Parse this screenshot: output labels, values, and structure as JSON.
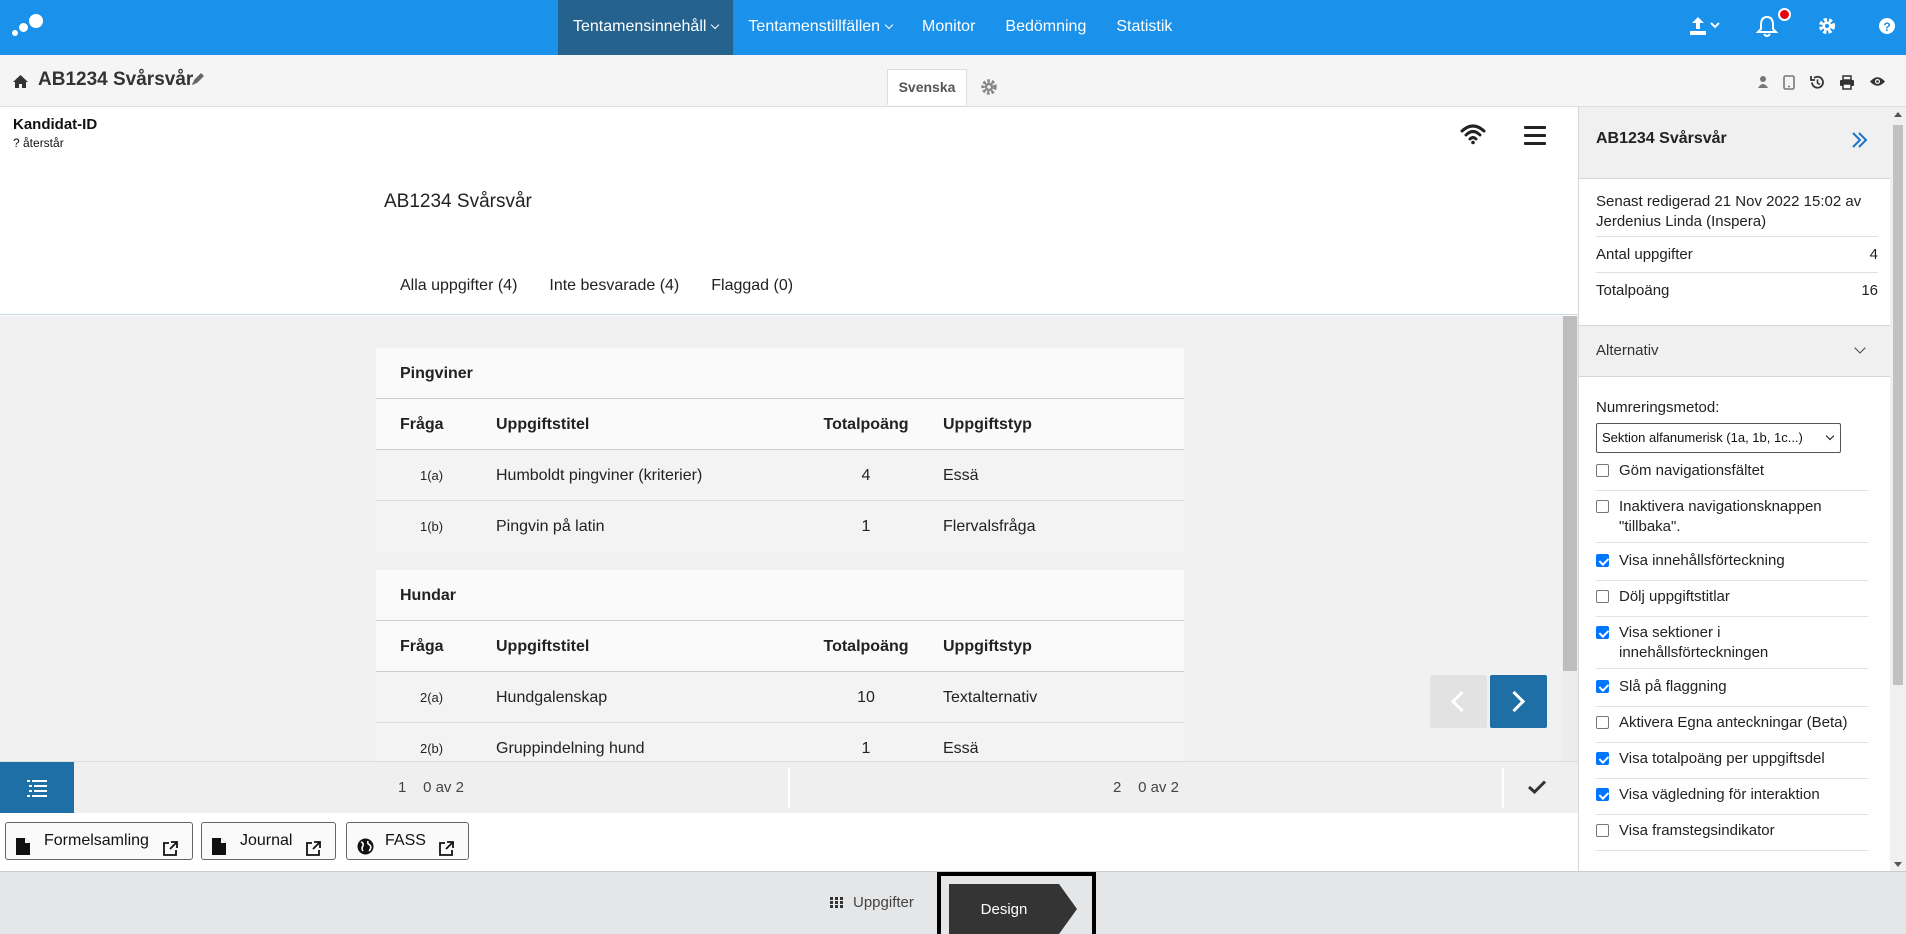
{
  "topnav": {
    "items": [
      {
        "label": "Tentamensinnehåll",
        "dropdown": true,
        "active": true
      },
      {
        "label": "Tentamenstillfällen",
        "dropdown": true,
        "active": false
      },
      {
        "label": "Monitor",
        "dropdown": false,
        "active": false
      },
      {
        "label": "Bedömning",
        "dropdown": false,
        "active": false
      },
      {
        "label": "Statistik",
        "dropdown": false,
        "active": false
      }
    ],
    "icons": [
      "upload-icon",
      "bell-icon",
      "gear-icon",
      "help-icon"
    ],
    "colors": {
      "bar": "#1a91ea",
      "active": "#25628e",
      "notification": "#e8000f"
    }
  },
  "subheader": {
    "title": "AB1234 Svårsvår",
    "language_tab": "Svenska",
    "tool_icons": [
      "person-icon",
      "tablet-icon",
      "history-icon",
      "print-icon",
      "eye-icon"
    ]
  },
  "candidate": {
    "id_label": "Kandidat-ID",
    "remaining": "? återstår"
  },
  "document": {
    "title": "AB1234 Svårsvår",
    "filters": [
      "Alla uppgifter (4)",
      "Inte besvarade (4)",
      "Flaggad (0)"
    ]
  },
  "table_headers": {
    "question": "Fråga",
    "title": "Uppgiftstitel",
    "points": "Totalpoäng",
    "type": "Uppgiftstyp"
  },
  "sections": [
    {
      "name": "Pingviner",
      "rows": [
        {
          "q": "1(a)",
          "title": "Humboldt pingviner (kriterier)",
          "points": "4",
          "type": "Essä"
        },
        {
          "q": "1(b)",
          "title": "Pingvin på latin",
          "points": "1",
          "type": "Flervalsfråga"
        }
      ]
    },
    {
      "name": "Hundar",
      "rows": [
        {
          "q": "2(a)",
          "title": "Hundgalenskap",
          "points": "10",
          "type": "Textalternativ"
        },
        {
          "q": "2(b)",
          "title": "Gruppindelning hund",
          "points": "1",
          "type": "Essä"
        }
      ]
    }
  ],
  "progress": {
    "segments": [
      {
        "num": "1",
        "status": "0 av 2"
      },
      {
        "num": "2",
        "status": "0 av 2"
      }
    ]
  },
  "resources": [
    {
      "label": "Formelsamling",
      "icon": "document-icon"
    },
    {
      "label": "Journal",
      "icon": "document-icon"
    },
    {
      "label": "FASS",
      "icon": "globe-icon"
    }
  ],
  "bottombar": {
    "tasks_label": "Uppgifter",
    "design_label": "Design"
  },
  "panel": {
    "title": "AB1234 Svårsvår",
    "last_edited": "Senast redigerad 21 Nov 2022 15:02 av Jerdenius Linda (Inspera)",
    "stats": [
      {
        "label": "Antal uppgifter",
        "value": "4"
      },
      {
        "label": "Totalpoäng",
        "value": "16"
      }
    ],
    "alternatives_label": "Alternativ",
    "numbering_label": "Numreringsmetod:",
    "numbering_value": "Sektion alfanumerisk (1a, 1b, 1c...)",
    "options": [
      {
        "label": "Göm navigationsfältet",
        "checked": false
      },
      {
        "label": "Inaktivera navigationsknappen \"tillbaka\".",
        "checked": false
      },
      {
        "label": "Visa innehållsförteckning",
        "checked": true
      },
      {
        "label": "Dölj uppgiftstitlar",
        "checked": false
      },
      {
        "label": "Visa sektioner i innehållsförteckningen",
        "checked": true
      },
      {
        "label": "Slå på flaggning",
        "checked": true
      },
      {
        "label": "Aktivera Egna anteckningar (Beta)",
        "checked": false
      },
      {
        "label": "Visa totalpoäng per uppgiftsdel",
        "checked": true
      },
      {
        "label": "Visa vägledning för interaktion",
        "checked": true
      },
      {
        "label": "Visa framstegsindikator",
        "checked": false
      }
    ]
  }
}
